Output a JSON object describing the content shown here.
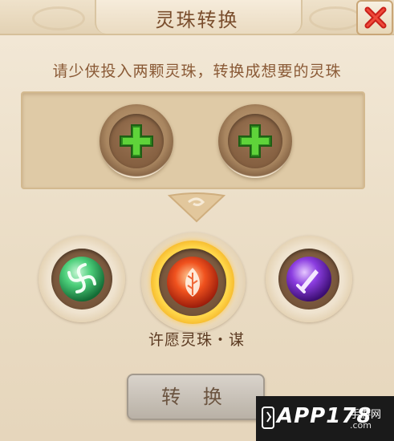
{
  "title": "灵珠转换",
  "instruction": "请少侠投入两颗灵珠，转换成想要的灵珠",
  "slots": [
    {
      "icon": "green-plus-icon"
    },
    {
      "icon": "green-plus-icon"
    }
  ],
  "orbs": [
    {
      "name": "green-wind-orb",
      "color": "#3fb866"
    },
    {
      "name": "red-flame-orb",
      "color": "#e0401c",
      "selected": true
    },
    {
      "name": "purple-sword-orb",
      "color": "#8a3fd6"
    }
  ],
  "selected_orb_label": "许愿灵珠・谋",
  "convert_button": "转 换",
  "watermark": {
    "main": "APP178",
    "sub": "手游网",
    "domain": ".com"
  }
}
